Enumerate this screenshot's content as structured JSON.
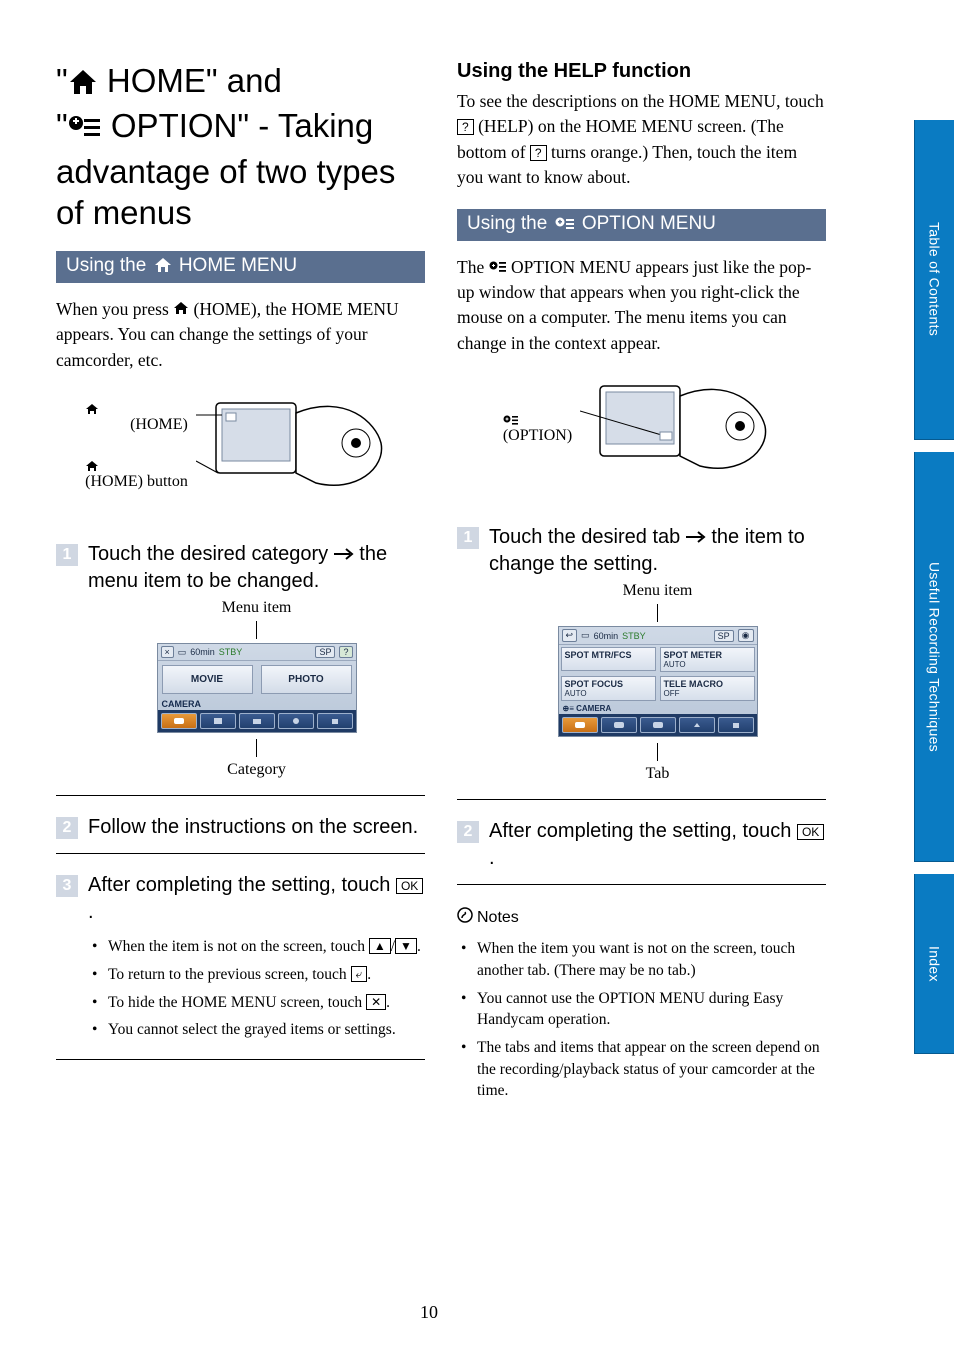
{
  "title_parts": {
    "q1": "\"",
    "home_word": " HOME\" and",
    "q2": "\"",
    "option_word": " OPTION\" - Taking advantage of two types of menus"
  },
  "left": {
    "section_bar_pre": "Using the ",
    "section_bar_post": " HOME MENU",
    "intro": "When you press ",
    "intro2": " (HOME), the HOME MENU appears. You can change the settings of your camcorder, etc.",
    "diag_label1a": " (HOME)",
    "diag_label2a": " (HOME) button",
    "step1": "Touch the desired category ",
    "step1b": " the menu item to be changed.",
    "menuitem_label": "Menu item",
    "category_label": "Category",
    "menu": {
      "back_icon": "×",
      "sixty": "60min",
      "stby": "STBY",
      "movie": "MOVIE",
      "photo": "PHOTO",
      "camera": "CAMERA"
    },
    "step2": "Follow the instructions on the screen.",
    "step3a": "After completing the setting, touch ",
    "ok": "OK",
    "bullets": [
      "When the item is not on the screen, touch ",
      "To return to the previous screen, touch ",
      "To hide the HOME MENU screen, touch ",
      "You cannot select the grayed items or settings."
    ],
    "b1_suffix": ".",
    "b2_suffix": ".",
    "b3_suffix": "."
  },
  "right": {
    "help_head": "Using the HELP function",
    "help_body1": "To see the descriptions on the HOME MENU, touch ",
    "help_body2": " (HELP) on the HOME MENU screen. (The bottom of ",
    "help_body3": " turns orange.) Then, touch the item you want to know about.",
    "section_bar_pre": "Using the ",
    "section_bar_post": " OPTION MENU",
    "intro1": "The ",
    "intro2": " OPTION MENU appears just like the pop-up window that appears when you right-click the mouse on a computer. The menu items you can change in the context appear.",
    "diag_label": " (OPTION)",
    "step1a": "Touch the desired tab ",
    "step1b": " the item to change the setting.",
    "menuitem_label": "Menu item",
    "tab_label": "Tab",
    "menu": {
      "sixty": "60min",
      "stby": "STBY",
      "spot_mtr_fcs": "SPOT MTR/FCS",
      "spot_meter": "SPOT METER",
      "auto": "AUTO",
      "spot_focus": "SPOT FOCUS",
      "tele_macro": "TELE MACRO",
      "off": "OFF",
      "camera": "CAMERA"
    },
    "step2a": "After completing the setting, touch ",
    "ok": "OK",
    "notes_head": "Notes",
    "notes": [
      "When the item you want is not on the screen, touch another tab. (There may be no tab.)",
      "You cannot use the OPTION MENU during Easy Handycam operation.",
      "The tabs and items that appear on the screen depend on the recording/playback status of your camcorder at the time."
    ]
  },
  "page_number": "10",
  "tabs": {
    "toc": "Table of Contents",
    "tech": "Useful Recording Techniques",
    "index": "Index"
  },
  "glyph": {
    "help_q": "?",
    "close_x": "✕",
    "back": "⤶",
    "up": "▲",
    "down": "▼",
    "slash": "/"
  }
}
